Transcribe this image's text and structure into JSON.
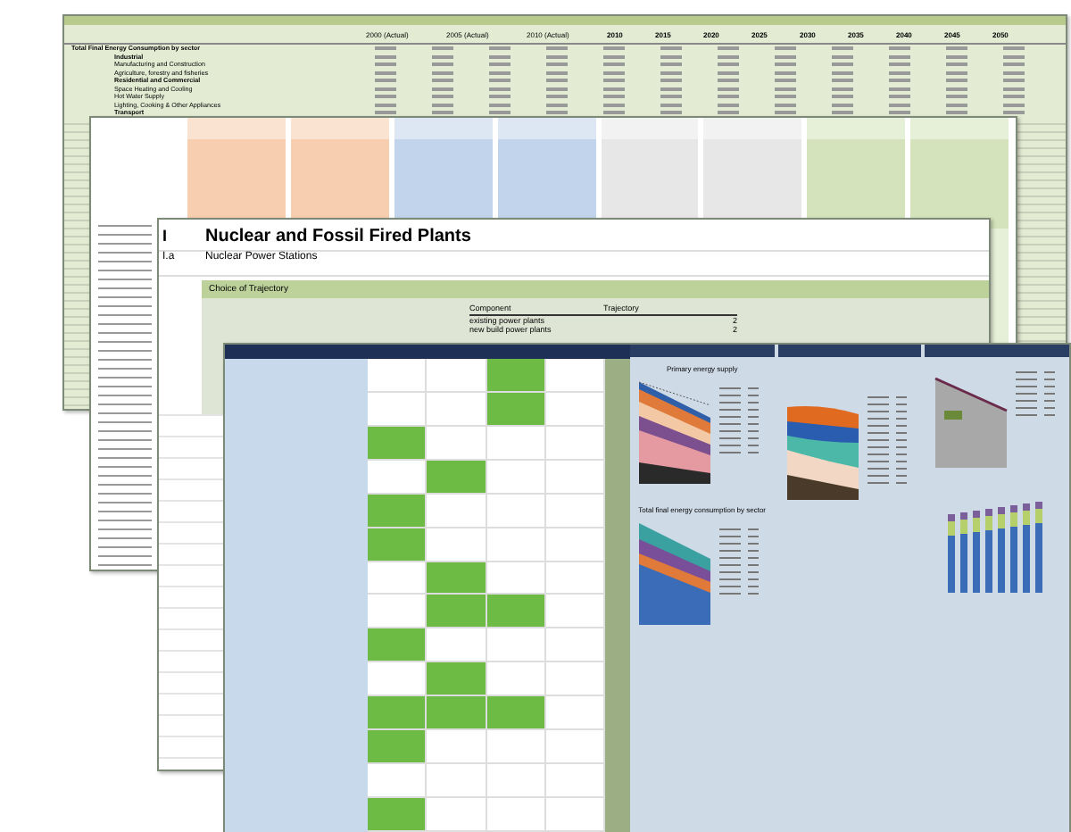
{
  "energy_sheet": {
    "column_headers": [
      "2000 (Actual)",
      "2005 (Actual)",
      "2010 (Actual)"
    ],
    "years": [
      "2010",
      "2015",
      "2020",
      "2025",
      "2030",
      "2035",
      "2040",
      "2045",
      "2050"
    ],
    "rows": [
      {
        "label": "Total Final Energy Consumption by sector",
        "kind": "heading"
      },
      {
        "label": "Industrial",
        "kind": "group"
      },
      {
        "label": "Manufacturing and Construction",
        "kind": "item"
      },
      {
        "label": "Agriculture, forestry and fisheries",
        "kind": "item"
      },
      {
        "label": "Residential and Commercial",
        "kind": "group"
      },
      {
        "label": "Space Heating and Cooling",
        "kind": "item"
      },
      {
        "label": "Hot Water Supply",
        "kind": "item"
      },
      {
        "label": "Lighting, Cooking & Other Appliances",
        "kind": "item"
      },
      {
        "label": "Transport",
        "kind": "group"
      }
    ]
  },
  "plants_sheet": {
    "section_number": "I",
    "title": "Nuclear and Fossil Fired Plants",
    "subsection_number": "I.a",
    "subtitle": "Nuclear Power Stations",
    "panel_title": "Choice of Trajectory",
    "table": {
      "columns": [
        "Component",
        "Trajectory"
      ],
      "rows": [
        {
          "component": "existing power plants",
          "trajectory": "2"
        },
        {
          "component": "new build power plants",
          "trajectory": "2"
        }
      ]
    }
  },
  "results_sheet": {
    "charts": [
      {
        "title": "Primary energy supply"
      },
      {
        "title": "Total final energy consumption by sector"
      }
    ]
  }
}
